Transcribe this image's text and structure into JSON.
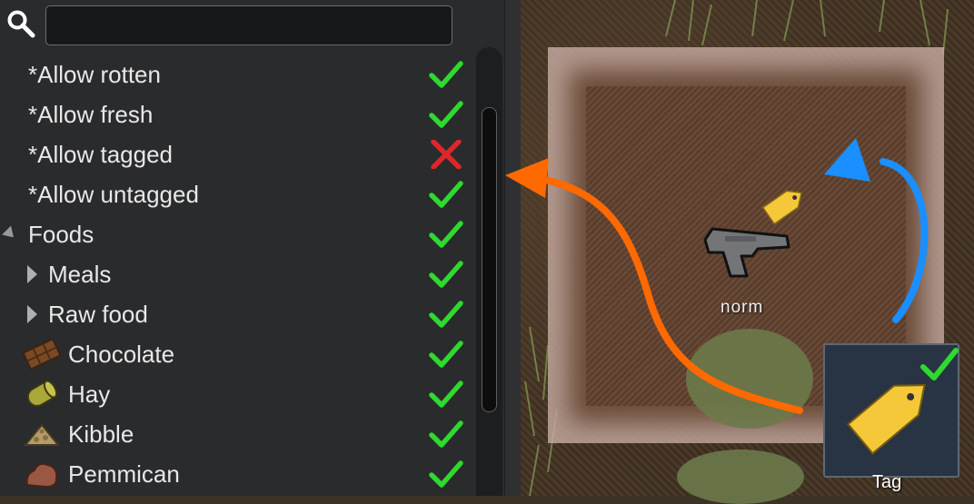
{
  "search": {
    "value": "",
    "placeholder": ""
  },
  "filters": [
    {
      "label": "*Allow rotten",
      "state": "allowed"
    },
    {
      "label": "*Allow fresh",
      "state": "allowed"
    },
    {
      "label": "*Allow tagged",
      "state": "disallowed"
    },
    {
      "label": "*Allow untagged",
      "state": "allowed"
    }
  ],
  "tree": [
    {
      "label": "Foods",
      "kind": "category-expanded",
      "state": "allowed"
    },
    {
      "label": "Meals",
      "kind": "category-collapsed",
      "state": "allowed"
    },
    {
      "label": "Raw food",
      "kind": "category-collapsed",
      "state": "allowed"
    },
    {
      "label": "Chocolate",
      "kind": "item",
      "icon": "chocolate-icon",
      "state": "allowed"
    },
    {
      "label": "Hay",
      "kind": "item",
      "icon": "hay-icon",
      "state": "allowed"
    },
    {
      "label": "Kibble",
      "kind": "item",
      "icon": "kibble-icon",
      "state": "allowed"
    },
    {
      "label": "Pemmican",
      "kind": "item",
      "icon": "pemmican-icon",
      "state": "allowed"
    }
  ],
  "map": {
    "item_label": "norm",
    "tag_button_label": "Tag",
    "tag_button_state": "checked"
  },
  "colors": {
    "check": "#2fd92f",
    "cross": "#e0262a",
    "orange_arrow": "#ff6a00",
    "blue_arrow": "#1a8fff",
    "tag": "#f5c83a"
  }
}
